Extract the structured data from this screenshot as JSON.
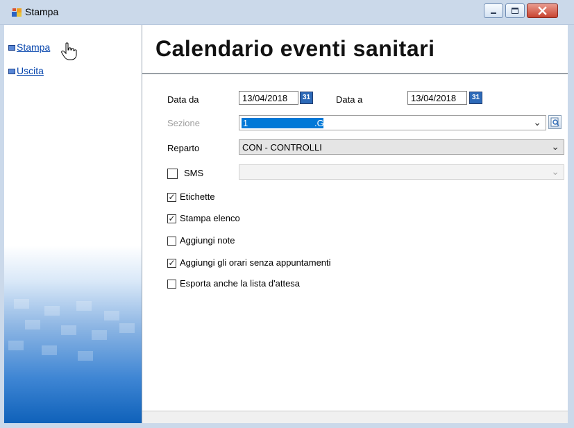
{
  "window": {
    "title": "Stampa"
  },
  "sidebar": {
    "items": [
      {
        "label": "Stampa"
      },
      {
        "label": "Uscita"
      }
    ]
  },
  "header": {
    "title": "Calendario eventi sanitari"
  },
  "form": {
    "data_da": {
      "label": "Data da",
      "value": "13/04/2018",
      "cal_icon": "31"
    },
    "data_a": {
      "label": "Data a",
      "value": "13/04/2018",
      "cal_icon": "31"
    },
    "sezione": {
      "label": "Sezione",
      "value_code": "1",
      "value_suffix": ".GO"
    },
    "reparto": {
      "label": "Reparto",
      "value": "CON - CONTROLLI"
    },
    "sms": {
      "label": "SMS",
      "checked": false,
      "value": ""
    },
    "checkboxes": [
      {
        "label": "Etichette",
        "checked": true
      },
      {
        "label": "Stampa elenco",
        "checked": true
      },
      {
        "label": "Aggiungi note",
        "checked": false
      },
      {
        "label": "Aggiungi gli orari senza appuntamenti",
        "checked": true
      },
      {
        "label": "Esporta anche la lista d'attesa",
        "checked": false
      }
    ]
  },
  "icons": {
    "app": "form-icon",
    "minimize": "minimize-icon",
    "maximize": "maximize-icon",
    "close": "close-icon",
    "calendar": "calendar-icon",
    "search": "lookup-icon",
    "cursor": "hand-pointer-icon"
  },
  "colors": {
    "titlebar": "#cbd9ea",
    "link": "#0645ad",
    "selection": "#0078d7",
    "close_button": "#c84431"
  }
}
